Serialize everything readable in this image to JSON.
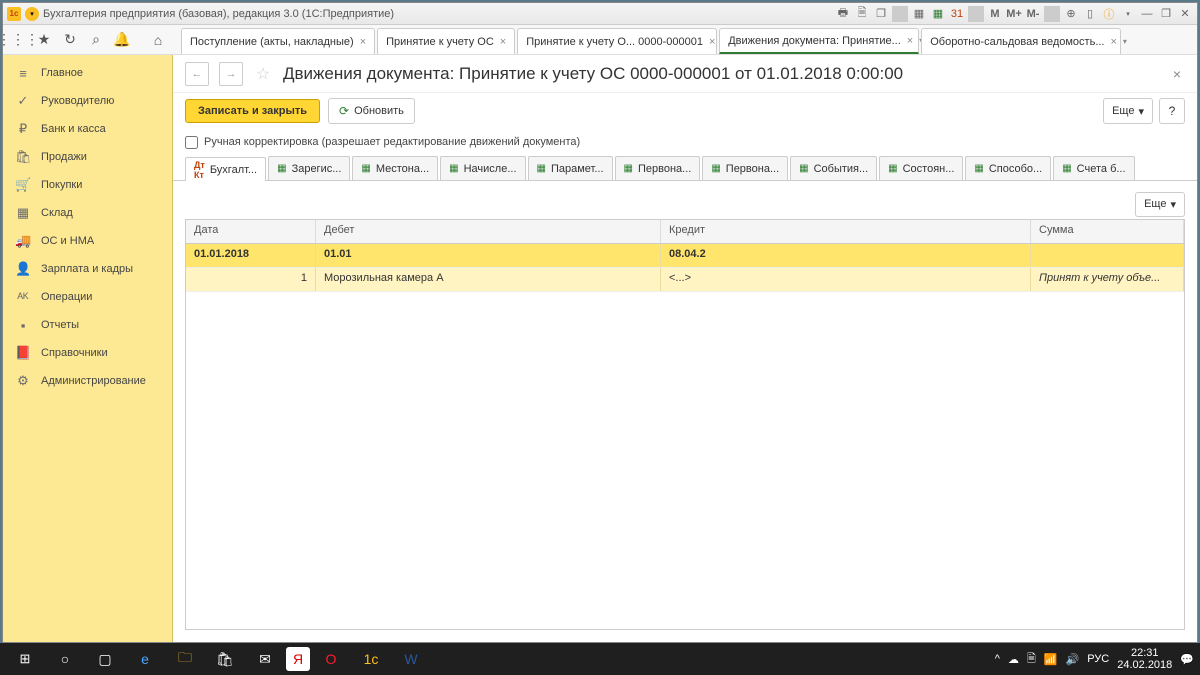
{
  "window_title": "Бухгалтерия предприятия (базовая), редакция 3.0  (1С:Предприятие)",
  "tb_icons": {
    "m": "M",
    "mp": "M+",
    "mm": "M-"
  },
  "app_tabs": [
    {
      "label": "Поступление (акты, накладные)",
      "close": "×"
    },
    {
      "label": "Принятие к учету ОС",
      "close": "×"
    },
    {
      "label": "Принятие к учету О... 0000-000001",
      "close": "×"
    },
    {
      "label": "Движения документа: Принятие...",
      "close": "×",
      "active": true
    },
    {
      "label": "Оборотно-сальдовая ведомость...",
      "close": "×"
    }
  ],
  "sidebar": [
    {
      "icon": "≡",
      "label": "Главное"
    },
    {
      "icon": "✓",
      "label": "Руководителю"
    },
    {
      "icon": "₽",
      "label": "Банк и касса"
    },
    {
      "icon": "🛍",
      "label": "Продажи"
    },
    {
      "icon": "🛒",
      "label": "Покупки"
    },
    {
      "icon": "▦",
      "label": "Склад"
    },
    {
      "icon": "🚚",
      "label": "ОС и НМА"
    },
    {
      "icon": "👤",
      "label": "Зарплата и кадры"
    },
    {
      "icon": "ᴬᴷ",
      "label": "Операции"
    },
    {
      "icon": "▪",
      "label": "Отчеты"
    },
    {
      "icon": "📕",
      "label": "Справочники"
    },
    {
      "icon": "⚙",
      "label": "Администрирование"
    }
  ],
  "doc": {
    "title": "Движения документа: Принятие к учету ОС 0000-000001 от 01.01.2018 0:00:00",
    "back": "←",
    "fwd": "→",
    "star": "☆",
    "close": "×"
  },
  "actions": {
    "primary": "Записать и закрыть",
    "refresh": "Обновить",
    "more": "Еще",
    "more_arrow": "▾",
    "help": "?"
  },
  "checkbox_label": "Ручная корректировка (разрешает редактирование движений документа)",
  "reg_tabs": [
    {
      "label": "Бухгалт...",
      "active": true,
      "type": "dtkt"
    },
    {
      "label": "Зарегис..."
    },
    {
      "label": "Местона..."
    },
    {
      "label": "Начисле..."
    },
    {
      "label": "Парамет..."
    },
    {
      "label": "Первона..."
    },
    {
      "label": "Первона..."
    },
    {
      "label": "События..."
    },
    {
      "label": "Состоян..."
    },
    {
      "label": "Способо..."
    },
    {
      "label": "Счета б..."
    }
  ],
  "grid_more": "Еще",
  "columns": {
    "date": "Дата",
    "debit": "Дебет",
    "credit": "Кредит",
    "sum": "Сумма"
  },
  "rows": [
    {
      "date": "01.01.2018",
      "debit": "01.01",
      "credit": "08.04.2",
      "sum": ""
    },
    {
      "date": "1",
      "debit": "Морозильная камера А",
      "credit": "<...>",
      "sum": "Принят к учету объе..."
    }
  ],
  "tray": {
    "lang": "РУС",
    "time": "22:31",
    "date": "24.02.2018",
    "up": "^"
  }
}
